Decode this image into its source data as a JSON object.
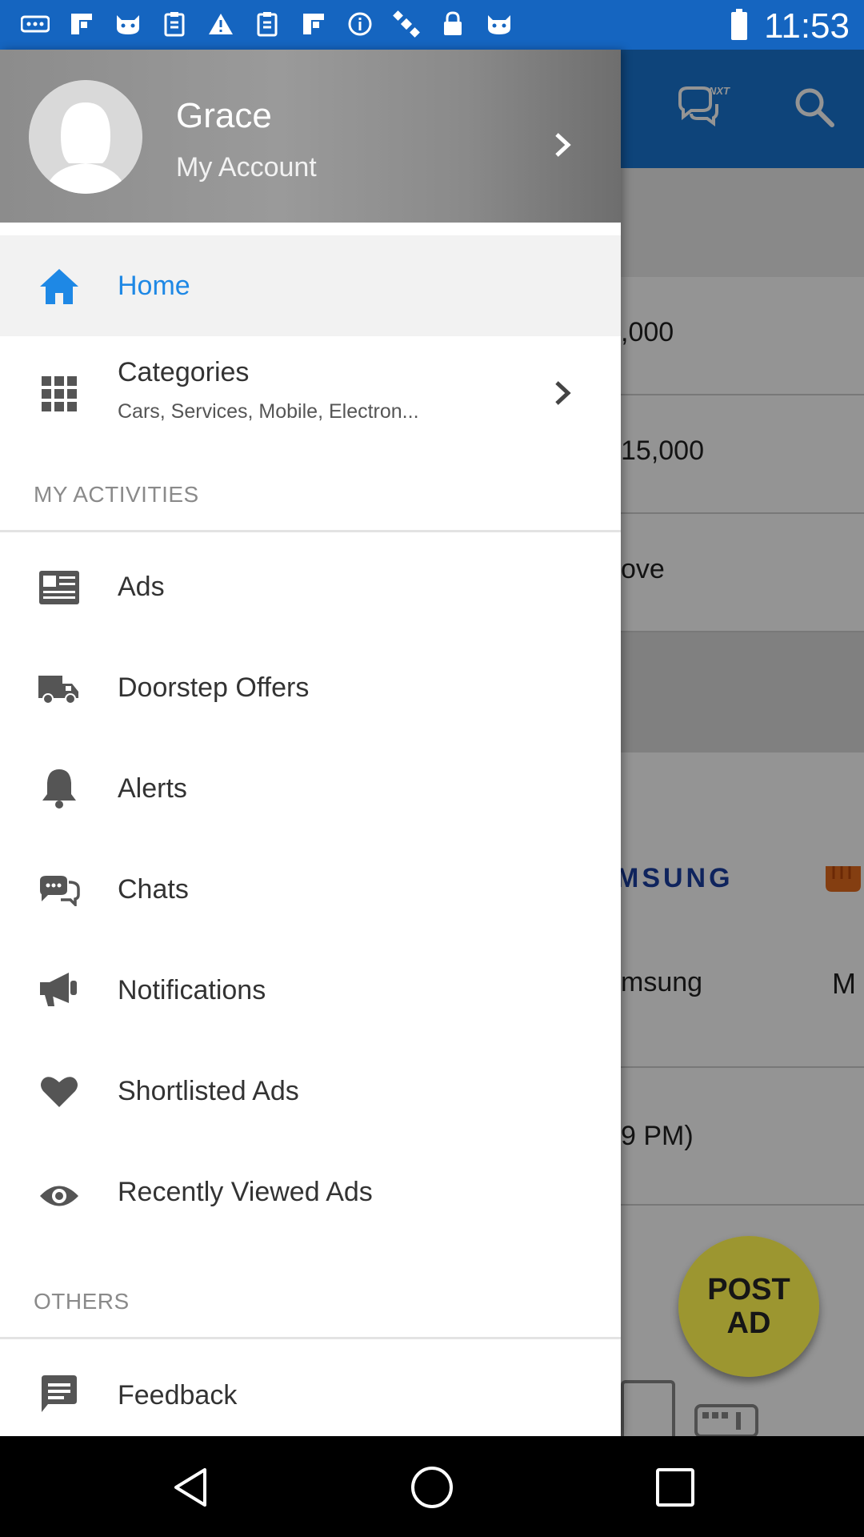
{
  "status_bar": {
    "time": "11:53",
    "icons": [
      "more-icon",
      "flipboard-icon",
      "cat-icon",
      "clipboard-icon",
      "warning-icon",
      "clipboard-icon",
      "flipboard-icon",
      "info-icon",
      "satellite-icon",
      "lock-icon",
      "cat-icon"
    ],
    "battery": "battery-icon"
  },
  "drawer": {
    "header": {
      "name": "Grace",
      "account_label": "My Account"
    },
    "items": [
      {
        "label": "Home",
        "icon": "home-icon",
        "active": true
      },
      {
        "label": "Categories",
        "sub": "Cars, Services, Mobile, Electron...",
        "icon": "grid-icon",
        "has_chevron": true
      }
    ],
    "sections": [
      {
        "title": "MY ACTIVITIES",
        "items": [
          {
            "label": "Ads",
            "icon": "news-icon"
          },
          {
            "label": "Doorstep Offers",
            "icon": "truck-icon"
          },
          {
            "label": "Alerts",
            "icon": "bell-icon"
          },
          {
            "label": "Chats",
            "icon": "chat-icon"
          },
          {
            "label": "Notifications",
            "icon": "megaphone-icon"
          },
          {
            "label": "Shortlisted Ads",
            "icon": "heart-icon"
          },
          {
            "label": "Recently Viewed Ads",
            "icon": "eye-icon"
          }
        ]
      },
      {
        "title": "OTHERS",
        "items": [
          {
            "label": "Feedback",
            "icon": "feedback-icon"
          }
        ]
      }
    ]
  },
  "background": {
    "toolbar_icons": [
      "chat-nxt-icon",
      "search-icon"
    ],
    "chat_badge": "NXT",
    "rows": [
      ",000",
      "15,000",
      "ove"
    ],
    "brand_samsung_logo": "MSUNG",
    "brand_samsung_label": "msung",
    "brand_m_label": "M",
    "time_row": "9 PM)",
    "fab": {
      "line1": "POST",
      "line2": "AD"
    }
  },
  "nav": [
    "back-icon",
    "home-icon",
    "recents-icon"
  ]
}
